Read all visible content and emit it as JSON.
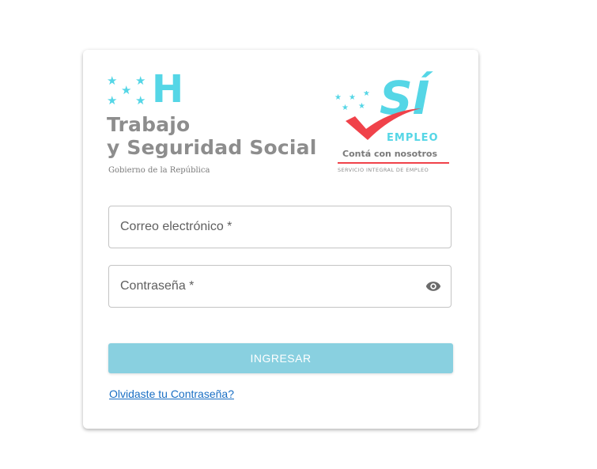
{
  "logo_left": {
    "mark": "H",
    "title_line1": "Trabajo",
    "title_line2": "y Seguridad Social",
    "subtitle": "Gobierno de la República",
    "star_glyph": "★",
    "color": "#55d6e6"
  },
  "logo_right": {
    "mark": "SÍ",
    "line": "EMPLEO",
    "slogan": "Contá con nosotros",
    "footer": "SERVICIO INTEGRAL DE EMPLEO",
    "check_color": "#f0424a",
    "color": "#55d6e6"
  },
  "form": {
    "email_label": "Correo electrónico *",
    "password_label": "Contraseña *",
    "password_toggle_icon": "eye-icon",
    "submit_label": "INGRESAR",
    "submit_color": "#89d0e0",
    "forgot_label": "Olvidaste tu Contraseña?",
    "link_color": "#1a6fc4"
  }
}
